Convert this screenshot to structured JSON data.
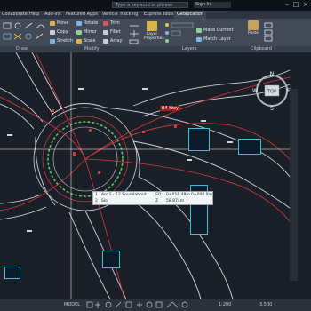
{
  "titlebar": {
    "search_text": "Type a keyword or phrase",
    "user_label": "Sign In",
    "minimize": "–",
    "maximize": "□",
    "close": "×"
  },
  "tabs": [
    {
      "label": "Collaborate"
    },
    {
      "label": "Help"
    },
    {
      "label": "Add-ins"
    },
    {
      "label": "Featured Apps"
    },
    {
      "label": "Vehicle Tracking"
    },
    {
      "label": "Express Tools"
    },
    {
      "label": "Geolocation"
    }
  ],
  "ribbon": {
    "modify_buttons": [
      "Move",
      "Rotate",
      "Trim",
      "Copy",
      "Mirror",
      "Fillet",
      "Stretch",
      "Scale",
      "Array"
    ],
    "layer_buttons": [
      "Layer Properties",
      "Make Current",
      "Match Layer"
    ],
    "paste_label": "Paste",
    "panels": [
      "Draw",
      "Modify",
      "Layers",
      "Clipboard"
    ]
  },
  "viewcube": {
    "top_label": "TOP",
    "north": "N",
    "south": "S",
    "east": "E",
    "west": "W"
  },
  "labels": {
    "red_label": "B4 Hwy",
    "tooltip_row1_num": "1",
    "tooltip_row1_text": "Arc 2 - 12 Roundabout",
    "tooltip_row1_code": "SO",
    "tooltip_row1_val": "0+016.48m",
    "tooltip_row1_val2": "0+000.0m",
    "tooltip_row2_num": "2",
    "tooltip_row2_text": "Slo",
    "tooltip_row2_code": "Z",
    "tooltip_row2_val": "58.874m"
  },
  "status": {
    "model": "MODEL",
    "scale": "1:200",
    "value": "3.500"
  },
  "colors": {
    "canvas": "#1b2028",
    "road_edge": "#cfd5dc",
    "centerline": "#d63b3b",
    "ring": "#5ac45a",
    "label_block": "#32c2d9"
  }
}
